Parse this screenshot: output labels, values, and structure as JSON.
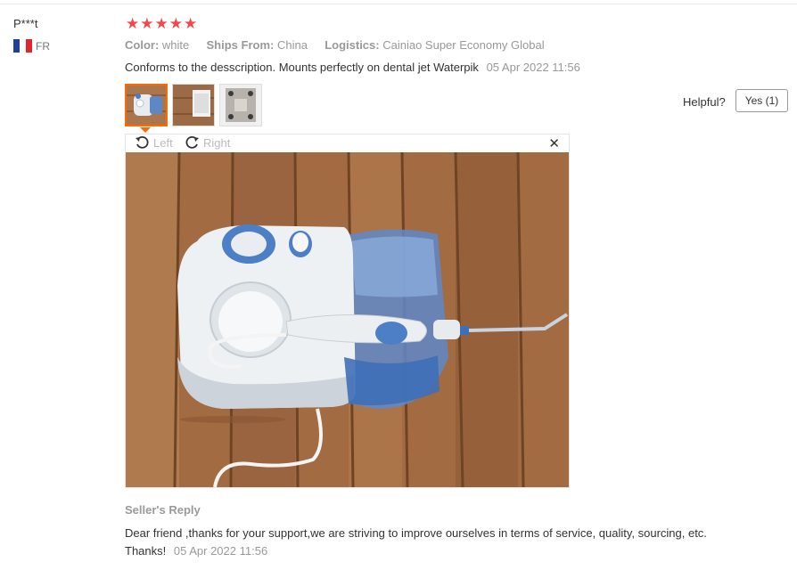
{
  "reviewer": {
    "name": "P***t",
    "country_code": "FR"
  },
  "rating": {
    "stars": 5,
    "max": 5
  },
  "meta": {
    "color_label": "Color:",
    "color_value": "white",
    "ships_label": "Ships From:",
    "ships_value": "China",
    "logistics_label": "Logistics:",
    "logistics_value": "Cainiao Super Economy Global"
  },
  "review": {
    "text": "Conforms to the desscription. Mounts perfectly on dental jet Waterpik",
    "date": "05 Apr 2022 11:56"
  },
  "helpful": {
    "label": "Helpful?",
    "button": "Yes (1)"
  },
  "viewer": {
    "rotate_left": "Left",
    "rotate_right": "Right",
    "close": "✕"
  },
  "seller_reply": {
    "heading": "Seller's Reply",
    "text": "Dear friend ,thanks for your support,we are striving to improve ourselves in terms of service, quality, sourcing, etc. Thanks!",
    "date": "05 Apr 2022 11:56"
  },
  "colors": {
    "star": "#ef4b4b",
    "accent": "#ff6a00",
    "flag_blue": "#1f3f9a",
    "flag_red": "#e1262d"
  },
  "icons": [
    "star-icon",
    "flag-fr-icon",
    "rotate-left-icon",
    "rotate-right-icon",
    "close-icon"
  ]
}
